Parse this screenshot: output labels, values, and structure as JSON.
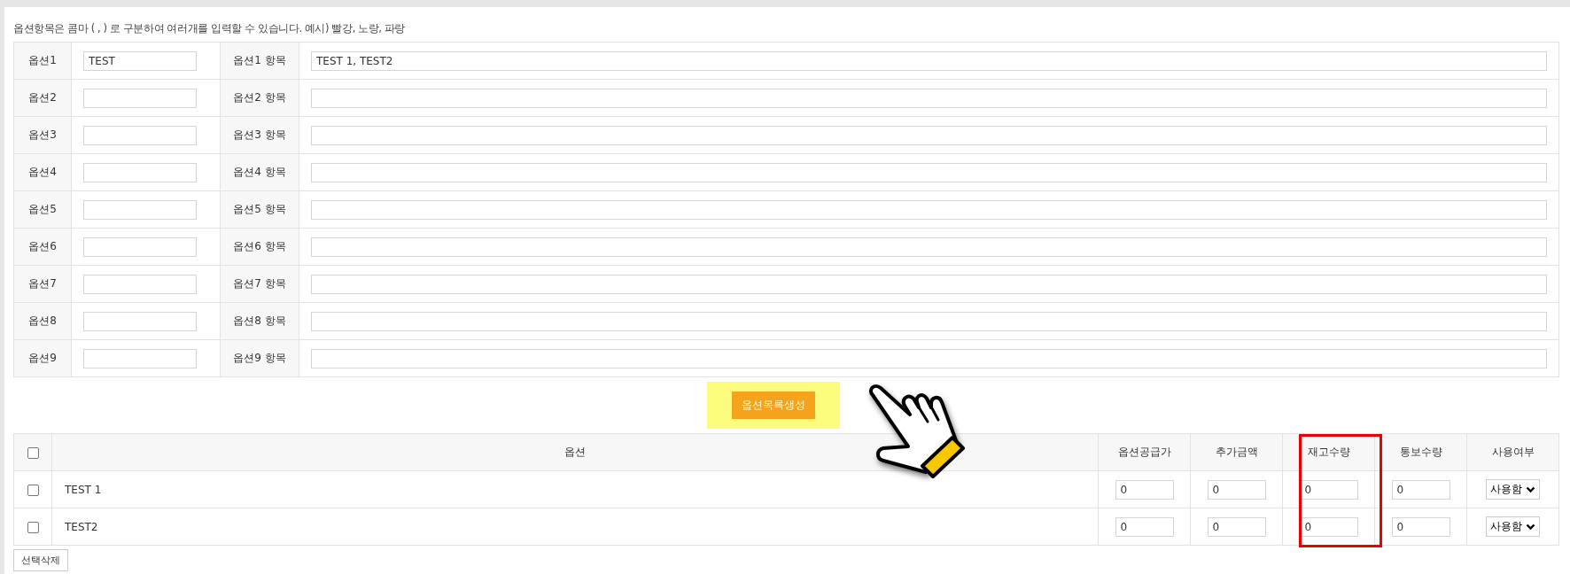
{
  "note": "옵션항목은 콤마 ( , ) 로 구분하여 여러개를 입력할 수 있습니다. 예시) 빨강, 노랑, 파랑",
  "options": [
    {
      "label": "옵션1",
      "value": "TEST",
      "items_label": "옵션1 항목",
      "items_value": "TEST 1, TEST2"
    },
    {
      "label": "옵션2",
      "items_label": "옵션2 항목"
    },
    {
      "label": "옵션3",
      "items_label": "옵션3 항목"
    },
    {
      "label": "옵션4",
      "items_label": "옵션4 항목"
    },
    {
      "label": "옵션5",
      "items_label": "옵션5 항목"
    },
    {
      "label": "옵션6",
      "items_label": "옵션6 항목"
    },
    {
      "label": "옵션7",
      "items_label": "옵션7 항목"
    },
    {
      "label": "옵션8",
      "items_label": "옵션8 항목"
    },
    {
      "label": "옵션9",
      "items_label": "옵션9 항목"
    }
  ],
  "generate_button": "옵션목록생성",
  "table": {
    "select_all_checked": false,
    "columns": [
      "옵션",
      "옵션공급가",
      "추가금액",
      "재고수량",
      "통보수량",
      "사용여부"
    ],
    "rows": [
      {
        "checked": false,
        "name": "TEST 1",
        "supply_price": "0",
        "extra_price": "0",
        "stock": "0",
        "alert_qty": "0",
        "use": "사용함"
      },
      {
        "checked": false,
        "name": "TEST2",
        "supply_price": "0",
        "extra_price": "0",
        "stock": "0",
        "alert_qty": "0",
        "use": "사용함"
      }
    ]
  },
  "delete_button": "선택삭제"
}
